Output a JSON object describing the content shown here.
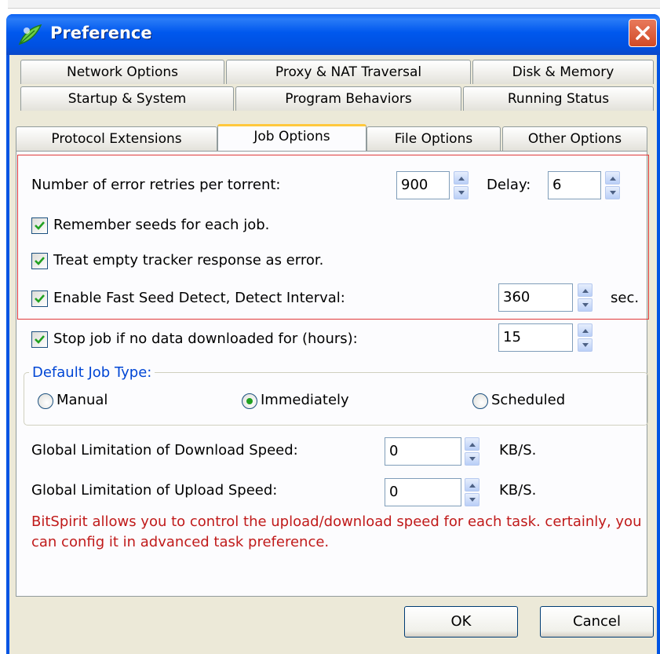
{
  "window": {
    "title": "Preference",
    "icon": "bitspirit-leaf-icon",
    "close_icon": "close-icon"
  },
  "tabs": {
    "row1": [
      "Network Options",
      "Proxy & NAT Traversal",
      "Disk & Memory"
    ],
    "row2": [
      "Startup & System",
      "Program Behaviors",
      "Running Status"
    ],
    "row3": [
      "Protocol Extensions",
      "Job Options",
      "File Options",
      "Other Options"
    ],
    "active": "Job Options"
  },
  "job_options": {
    "error_retries_label": "Number of error retries per torrent:",
    "error_retries_value": "900",
    "delay_label": "Delay:",
    "delay_value": "6",
    "remember_seeds_label": "Remember seeds for each job.",
    "remember_seeds_checked": true,
    "treat_empty_label": "Treat empty tracker response as error.",
    "treat_empty_checked": true,
    "fast_seed_label": "Enable Fast Seed Detect, Detect Interval:",
    "fast_seed_checked": true,
    "fast_seed_value": "360",
    "fast_seed_unit": "sec.",
    "stop_job_label": "Stop job if no data downloaded for (hours):",
    "stop_job_checked": true,
    "stop_job_value": "15"
  },
  "default_job_type": {
    "title": "Default Job Type:",
    "options": [
      "Manual",
      "Immediately",
      "Scheduled"
    ],
    "selected": "Immediately"
  },
  "speed": {
    "download_label": "Global Limitation of Download Speed:",
    "download_value": "0",
    "download_unit": "KB/S.",
    "upload_label": "Global Limitation of Upload Speed:",
    "upload_value": "0",
    "upload_unit": "KB/S."
  },
  "note": "BitSpirit allows you to control the upload/download speed for each task. certainly, you can config it in advanced task preference.",
  "buttons": {
    "ok": "OK",
    "cancel": "Cancel"
  },
  "colors": {
    "titlebar": "#0058ee",
    "dialog_bg": "#ece9d8",
    "active_tab_accent": "#ffc83c",
    "highlight_border": "#e03a3a",
    "note_text": "#c01a1a",
    "group_title": "#0046d5",
    "check_mark": "#21a121"
  }
}
